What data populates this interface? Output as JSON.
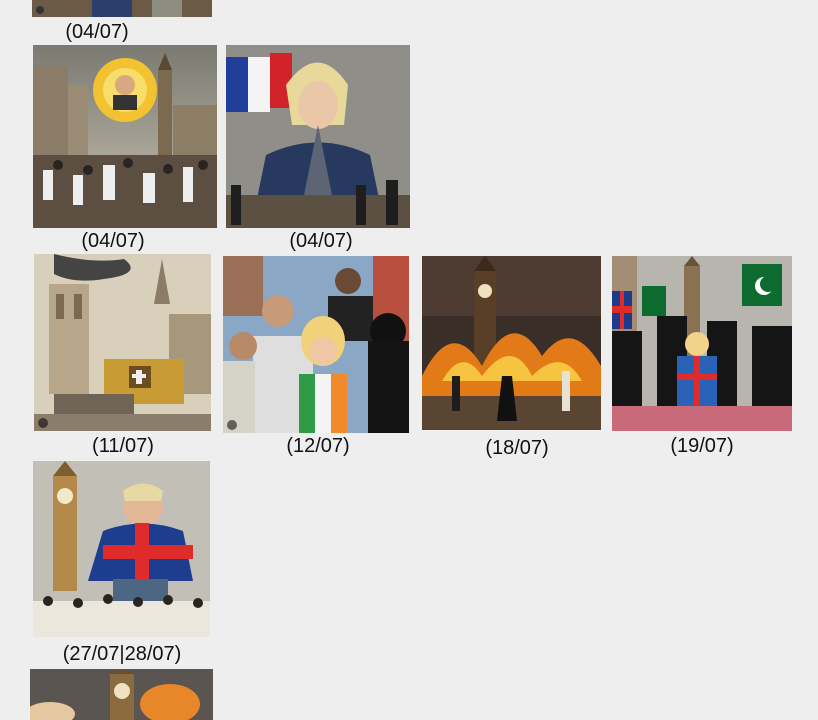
{
  "gallery": {
    "items": [
      {
        "date": "(04/07)"
      },
      {
        "date": "(04/07)"
      },
      {
        "date": "(04/07)"
      },
      {
        "date": "(11/07)"
      },
      {
        "date": "(12/07)"
      },
      {
        "date": "(18/07)"
      },
      {
        "date": "(19/07)"
      },
      {
        "date": "(27/07|28/07)"
      },
      {
        "date": ""
      }
    ]
  },
  "colors": {
    "background": "#eeeeee",
    "text": "#111111"
  }
}
